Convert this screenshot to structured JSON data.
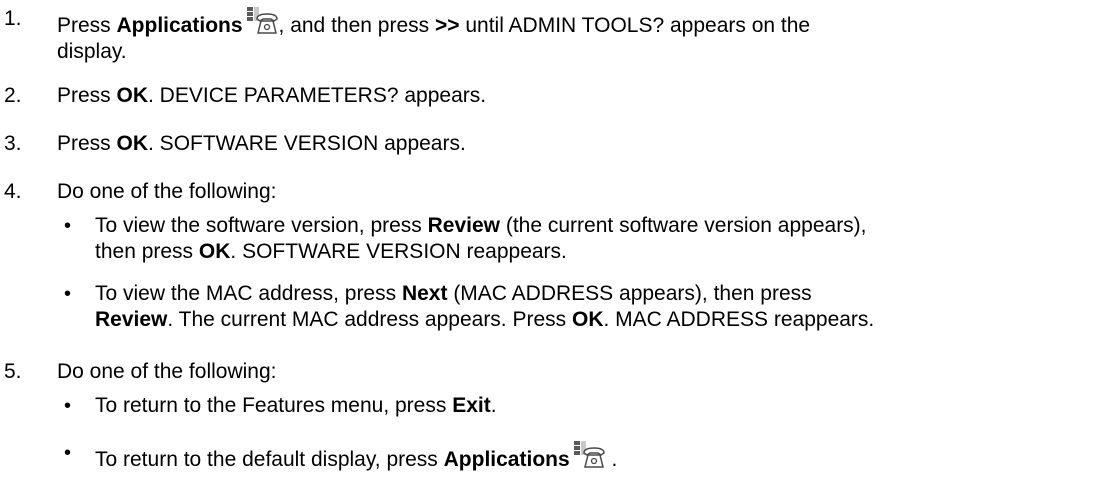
{
  "steps": [
    {
      "number": "1.",
      "parts": {
        "a": "Press ",
        "b": "Applications",
        "c": ", and then press ",
        "d": ">>",
        "e": " until ADMIN TOOLS? appears on the",
        "f": "display."
      },
      "icon": "applications-phone-icon"
    },
    {
      "number": "2.",
      "parts": {
        "a": "Press ",
        "b": "OK",
        "c": ". DEVICE PARAMETERS? appears."
      }
    },
    {
      "number": "3.",
      "parts": {
        "a": "Press ",
        "b": "OK",
        "c": ". SOFTWARE VERSION appears."
      }
    },
    {
      "number": "4.",
      "text": "Do one of the following:",
      "bullets": [
        {
          "a": "To view the software version, press ",
          "b": "Review",
          "c": " (the current software version appears),",
          "d": "then press ",
          "e": "OK",
          "f": ". SOFTWARE VERSION reappears."
        },
        {
          "a": "To view the MAC address, press ",
          "b": "Next",
          "c": " (MAC ADDRESS appears), then press",
          "d": "Review",
          "e": ". The current MAC address appears. Press ",
          "f": "OK",
          "g": ". MAC ADDRESS reappears."
        }
      ]
    },
    {
      "number": "5.",
      "text": "Do one of the following:",
      "bullets": [
        {
          "a": "To return to the Features menu, press ",
          "b": "Exit",
          "c": "."
        },
        {
          "a": "To return to the default display, press ",
          "b": "Applications",
          "c": " ."
        }
      ]
    }
  ],
  "bullet_glyph": "•",
  "icon_colors": {
    "stroke": "#4a4a4a",
    "fill_dark": "#5a5a5a",
    "fill_light": "#c8c8c8"
  }
}
